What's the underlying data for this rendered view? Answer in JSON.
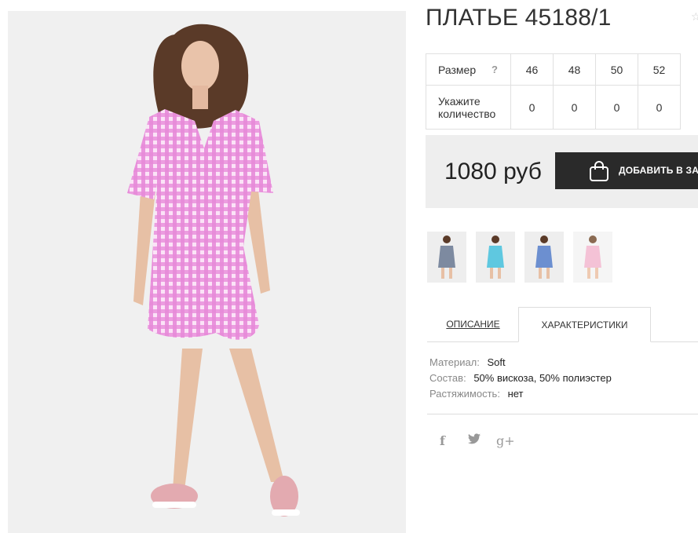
{
  "product": {
    "title": "ПЛАТЬЕ 45188/1",
    "image": {
      "subject": "Model wearing pink checked shirt dress",
      "background": "#f0f0f0",
      "dress_color": "#e88fd6"
    }
  },
  "sizes": {
    "size_label": "Размер",
    "help_symbol": "?",
    "qty_label": "Укажите количество",
    "columns": [
      "46",
      "48",
      "50",
      "52"
    ],
    "quantities": [
      "0",
      "0",
      "0",
      "0"
    ]
  },
  "price": {
    "amount": "1080 руб",
    "button_label": "ДОБАВИТЬ В ЗАКАЗ"
  },
  "thumbnails": [
    {
      "name": "thumb-grey-dress",
      "color": "#7d8aa0"
    },
    {
      "name": "thumb-turquoise-dress",
      "color": "#5fc8e0"
    },
    {
      "name": "thumb-blue-dress",
      "color": "#6c8fd0"
    },
    {
      "name": "thumb-pink-dress",
      "color": "#f4c2d6"
    }
  ],
  "tabs": [
    {
      "label": "Описание",
      "active": false
    },
    {
      "label": "Характеристики",
      "active": true
    }
  ],
  "specs": [
    {
      "key": "Материал:",
      "value": "Soft"
    },
    {
      "key": "Состав:",
      "value": "50% вискоза, 50% полиэстер"
    },
    {
      "key": "Растяжимость:",
      "value": "нет"
    }
  ],
  "social": {
    "facebook": "f",
    "twitter": "twitter-icon",
    "google": "g+"
  },
  "colors": {
    "button": "#2a2a2a",
    "price_bg": "#eeeeee",
    "border": "#e0e0e0"
  }
}
